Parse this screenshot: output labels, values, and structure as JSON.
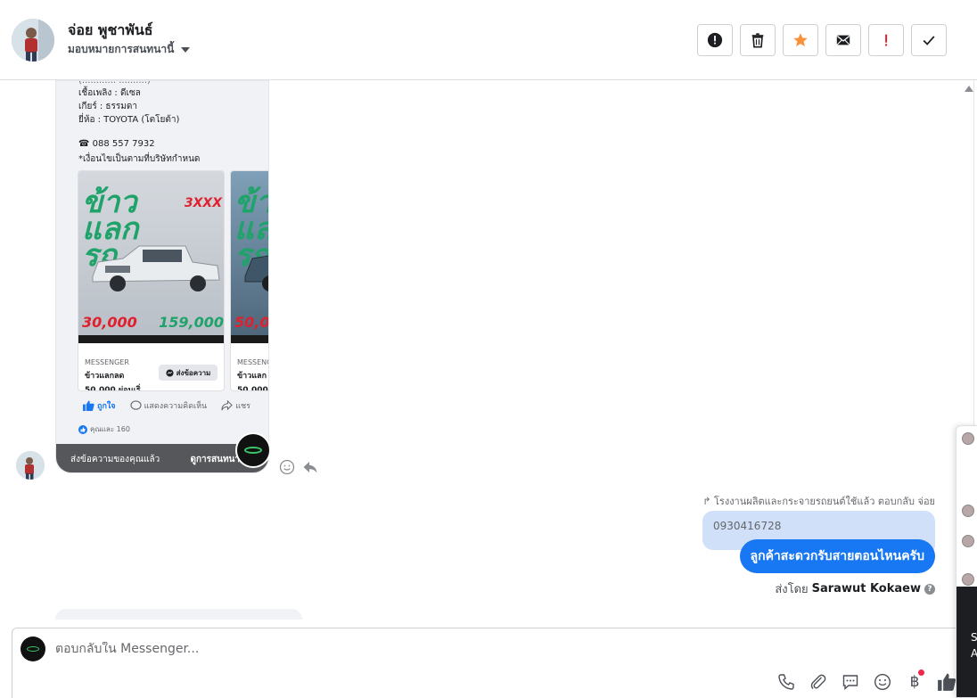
{
  "header": {
    "contact_name": "จ่อย พูชาพันธ์",
    "assign_label": "มอบหมายการสนทนานี้",
    "actions": [
      {
        "name": "spam-button",
        "icon": "alert-circle-icon"
      },
      {
        "name": "delete-button",
        "icon": "trash-icon"
      },
      {
        "name": "star-button",
        "icon": "star-icon"
      },
      {
        "name": "mark-unread-button",
        "icon": "envelope-icon"
      },
      {
        "name": "follow-up-button",
        "icon": "exclamation-icon"
      },
      {
        "name": "mark-done-button",
        "icon": "check-icon"
      }
    ]
  },
  "shared_post": {
    "lines": {
      "fuel": "เชื้อเพลิง : ดีเซล",
      "gear": "เกียร์ : ธรรมดา",
      "brand": "ยี่ห้อ : TOYOTA (โตโยต้า)",
      "phone": "☎ 088 557 7932",
      "condition": "*เงื่อนไขเป็นตามที่บริษัทกำหนด"
    },
    "cards": [
      {
        "image_title": "ข้าว\nแลก\nรถ",
        "promo": "3XXX",
        "price_down": "30,000",
        "price_remaining": "159,000",
        "source": "MESSENGER",
        "title1": "ข้าวแลกลด",
        "title2": "50,000 ผ่อนเริ่...",
        "button": "ส่งข้อความ"
      },
      {
        "image_title": "ข้าว\nแลก\nรถ",
        "price_down": "50,0",
        "source": "MESSENG",
        "title1": "ข้าวแลก",
        "title2": "50,000 ผ่"
      }
    ],
    "like_label": "ถูกใจ",
    "comment_label": "แสดงความคิดเห็น",
    "share_label": "แชร",
    "reactions": "คุณและ 160",
    "footer_left": "ส่งข้อความของคุณแล้ว",
    "footer_right": "ดูการสนทนา"
  },
  "outgoing": {
    "reply_note": "โรงงานผลิตและกระจายรถยนต์ใช้แล้ว ตอบกลับ จ่อย",
    "quoted_text": "0930416728",
    "message": "ลูกค้าสะดวกรับสายตอนไหนครับ",
    "sent_by_prefix": "ส่งโดย",
    "sent_by_name": "Sarawut Kokaew"
  },
  "composer": {
    "placeholder": "ตอบกลับใน Messenger...",
    "tools": [
      "phone-icon",
      "paperclip-icon",
      "saved-reply-icon",
      "emoji-icon",
      "baht-payment-icon",
      "thumbs-up-icon"
    ],
    "baht_symbol": "฿"
  },
  "side_peek": {
    "letters": [
      "S",
      "A"
    ]
  },
  "colors": {
    "accent": "#1877f2",
    "quoted_bg": "#cfe0f8",
    "star": "#f7923b",
    "danger": "#e0202e"
  }
}
